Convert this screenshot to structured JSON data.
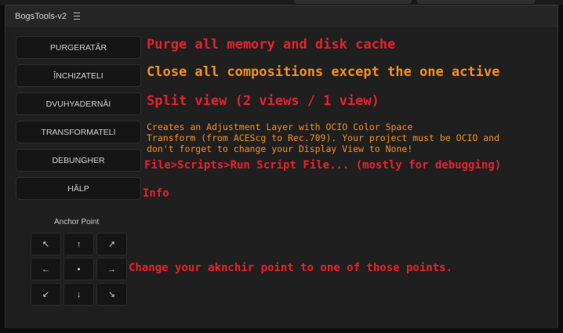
{
  "panel": {
    "title": "BogsTools-v2",
    "menu_icon": "hamburger-menu-icon"
  },
  "buttons": [
    {
      "label": "PURGERATĂR"
    },
    {
      "label": "ÎNCHIZATELI"
    },
    {
      "label": "DVUHYADERNĂI"
    },
    {
      "label": "TRANSFORMATELI"
    },
    {
      "label": "DEBUNGHER"
    },
    {
      "label": "HĂLP"
    }
  ],
  "descriptions": {
    "purge": "Purge all memory and disk cache",
    "close": "Close all compositions except the one active",
    "split": "Split view (2 views / 1 view)",
    "transform_lines": [
      "Creates an Adjustment Layer with OCIO Color Space",
      "Transform (from ACEScg to Rec.709). Your project must be OCIO and",
      "don't forget to change your Display View to None!"
    ],
    "debug": "File>Scripts>Run Script File... (mostly for debugging)",
    "help": "Info"
  },
  "anchor": {
    "label": "Anchor Point",
    "cells": [
      "↖",
      "↑",
      "↗",
      "←",
      "•",
      "→",
      "↙",
      "↓",
      "↘"
    ],
    "description": "Change your aknchir point to one of those points."
  },
  "colors": {
    "red": "#e8212a",
    "orange": "#f0901e"
  }
}
